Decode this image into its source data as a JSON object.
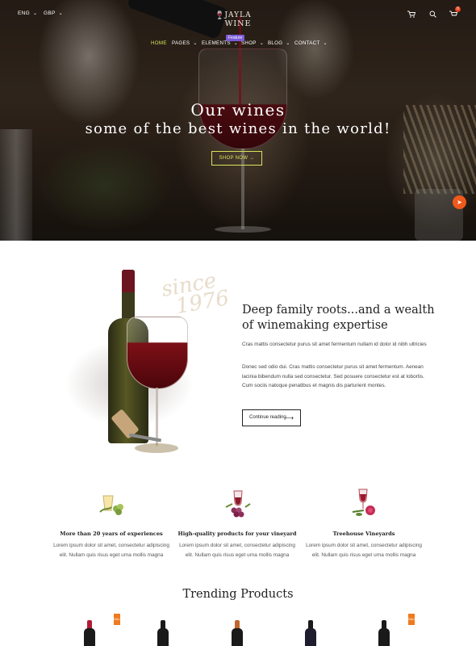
{
  "topbar": {
    "language": "ENG",
    "currency": "GBP",
    "brand_line1": "JAYLA",
    "brand_line2": "WINE",
    "cart_count": "0"
  },
  "nav": {
    "items": [
      {
        "label": "HOME",
        "active": true
      },
      {
        "label": "PAGES"
      },
      {
        "label": "ELEMENTS"
      },
      {
        "label": "SHOP"
      },
      {
        "label": "BLOG"
      },
      {
        "label": "CONTACT"
      }
    ],
    "feature_badge": "Feature"
  },
  "hero": {
    "title": "Our wines",
    "subtitle": "some of the best wines in the world!",
    "button": "SHOP NOW →"
  },
  "about": {
    "since_line1": "since",
    "since_line2": "1976",
    "heading": "Deep family roots...and a wealth of winemaking expertise",
    "p1": "Cras mattis consectetur purus sit amet fermentum nullam id dolor id nibh ultricies",
    "p2": "Donec sed odio dui. Cras mattis consectetur purus sit amet fermentum. Aenean lacinia bibendum nulla sed consectetur. Sed posuere consectetur est at lobortis. Cum sociis natoque penatibus et magnis dis parturient montes.",
    "button": "Continue reading"
  },
  "features": [
    {
      "title": "More than 20 years of experiences",
      "desc": "Lorem ipsum dolor sit amet, consectetur adipiscing elit. Nullam quis risus eget urna mollis magna"
    },
    {
      "title": "High-quality products for your vineyard",
      "desc": "Lorem ipsum dolor sit amet, consectetur adipiscing elit. Nullam quis risus eget urna mollis magna"
    },
    {
      "title": "Treehouse Vineyards",
      "desc": "Lorem ipsum dolor sit amet, consectetur adipiscing elit. Nullam quis risus eget urna mollis magna"
    }
  ],
  "trending": {
    "heading": "Trending Products",
    "sale_label": "SALE"
  },
  "colors": {
    "accent": "#d8e45a",
    "orange": "#ef5a1c",
    "feature_badge": "#7b5cd6"
  }
}
